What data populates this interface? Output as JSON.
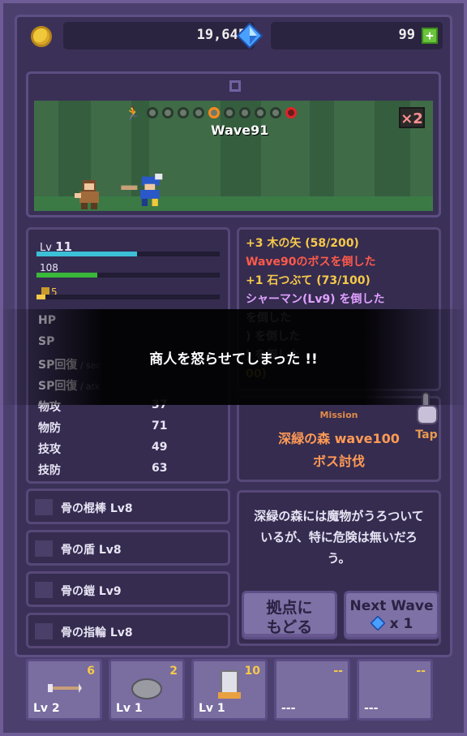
{
  "currency": {
    "gold": "19,645",
    "gems": "99",
    "add_icon": "plus-icon"
  },
  "stage": {
    "wave_label": "Wave91",
    "speed_multiplier": "×2",
    "progress_nodes": 10,
    "current_node": 5
  },
  "player": {
    "level_label": "Lv",
    "level": "11",
    "hp_current": "108",
    "sp_current": "5",
    "xp_fraction": 0.55,
    "hp_fraction": 0.33,
    "sp_fraction": 0.05
  },
  "stats": [
    {
      "name": "HP",
      "sub": "",
      "value": ""
    },
    {
      "name": "SP",
      "sub": "",
      "value": ""
    },
    {
      "name": "SP回復",
      "sub": "/ sec",
      "value": ""
    },
    {
      "name": "SP回復",
      "sub": "/ atk",
      "value": ""
    },
    {
      "name": "物攻",
      "sub": "",
      "value": "37"
    },
    {
      "name": "物防",
      "sub": "",
      "value": "71"
    },
    {
      "name": "技攻",
      "sub": "",
      "value": "49"
    },
    {
      "name": "技防",
      "sub": "",
      "value": "63"
    }
  ],
  "log": [
    {
      "text": "+3 木の矢 (58/200)",
      "color": "#f6c94a"
    },
    {
      "text": "Wave90のボスを倒した",
      "color": "#ff5a4a"
    },
    {
      "text": "+1 石つぶて (73/100)",
      "color": "#f6c94a"
    },
    {
      "text": "シャーマン(Lv9) を倒した",
      "color": "#e0a0ff"
    },
    {
      "text": "を倒した",
      "color": "#e8e4f4"
    },
    {
      "text": ") を倒した",
      "color": "#e8e4f4"
    },
    {
      "text": ") を倒した",
      "color": "#e8e4f4"
    },
    {
      "text": "00)",
      "color": "#f6c94a"
    }
  ],
  "mission": {
    "label": "Mission",
    "line1": "深緑の森 wave100",
    "line2": "ボス討伐",
    "tap": "Tap"
  },
  "equipment": [
    {
      "name": "骨の棍棒 Lv8",
      "icon": "sword-icon"
    },
    {
      "name": "骨の盾 Lv8",
      "icon": "shield-icon"
    },
    {
      "name": "骨の鎧 Lv9",
      "icon": "armor-icon"
    },
    {
      "name": "骨の指輪 Lv8",
      "icon": "ring-icon"
    }
  ],
  "description": "深緑の森には魔物がうろついているが、特に危険は無いだろう。",
  "buttons": {
    "home": "拠点に\nもどる",
    "next_wave": "Next Wave",
    "next_wave_cost": "x 1"
  },
  "slots": [
    {
      "count": "6",
      "level": "Lv 2",
      "icon": "arrow-icon"
    },
    {
      "count": "2",
      "level": "Lv 1",
      "icon": "stone-icon"
    },
    {
      "count": "10",
      "level": "Lv 1",
      "icon": "tower-icon"
    },
    {
      "count": "--",
      "level": "---",
      "icon": ""
    },
    {
      "count": "--",
      "level": "---",
      "icon": ""
    }
  ],
  "toast": "商人を怒らせてしまった !!"
}
